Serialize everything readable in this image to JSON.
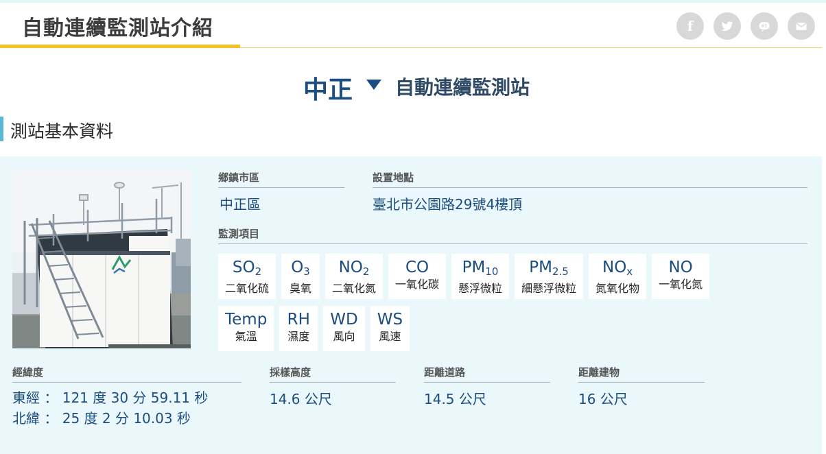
{
  "header": {
    "title": "自動連續監測站介紹",
    "social": [
      {
        "icon": "facebook-icon",
        "glyph": "f"
      },
      {
        "icon": "twitter-icon",
        "glyph": ""
      },
      {
        "icon": "line-icon",
        "glyph": ""
      },
      {
        "icon": "mail-icon",
        "glyph": ""
      }
    ]
  },
  "station": {
    "name": "中正",
    "suffix": "自動連續監測站"
  },
  "section": {
    "title": "測站基本資料"
  },
  "info": {
    "district_label": "鄉鎮市區",
    "district_value": "中正區",
    "address_label": "設置地點",
    "address_value": "臺北市公園路29號4樓頂",
    "items_label": "監測項目"
  },
  "items_row1": [
    {
      "base": "SO",
      "sub": "2",
      "name": "二氧化硫"
    },
    {
      "base": "O",
      "sub": "3",
      "name": "臭氧"
    },
    {
      "base": "NO",
      "sub": "2",
      "name": "二氧化氮"
    },
    {
      "base": "CO",
      "sub": "",
      "name": "一氧化碳"
    },
    {
      "base": "PM",
      "sub": "10",
      "name": "懸浮微粒"
    },
    {
      "base": "PM",
      "sub": "2.5",
      "name": "細懸浮微粒"
    },
    {
      "base": "NO",
      "sub": "x",
      "name": "氮氧化物"
    },
    {
      "base": "NO",
      "sub": "",
      "name": "一氧化氮"
    }
  ],
  "items_row2": [
    {
      "base": "Temp",
      "sub": "",
      "name": "氣溫"
    },
    {
      "base": "RH",
      "sub": "",
      "name": "濕度"
    },
    {
      "base": "WD",
      "sub": "",
      "name": "風向"
    },
    {
      "base": "WS",
      "sub": "",
      "name": "風速"
    }
  ],
  "location": {
    "coord_label": "經緯度",
    "longitude": "東經 ： 121 度 30 分 59.11 秒",
    "latitude": "北緯 ： 25 度 2 分 10.03 秒",
    "height_label": "採樣高度",
    "height_value": "14.6 公尺",
    "road_label": "距離道路",
    "road_value": "14.5 公尺",
    "building_label": "距離建物",
    "building_value": "16 公尺"
  },
  "colors": {
    "accent_yellow": "#f5c228",
    "title_blue": "#1c4d80",
    "panel_bg": "#eaf8fb",
    "section_bar": "#5bb8d8",
    "social_grey": "#d8d8d8"
  }
}
